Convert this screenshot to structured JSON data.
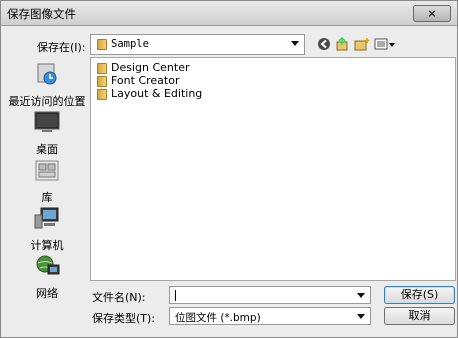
{
  "window": {
    "title": "保存图像文件",
    "close_label": "×"
  },
  "location": {
    "label": "保存在(I):",
    "folder": "Sample"
  },
  "toolbar": {
    "icons": [
      "back-icon",
      "up-folder-icon",
      "new-folder-icon",
      "view-menu-icon"
    ]
  },
  "places": [
    {
      "label": "最近访问的位置",
      "icon": "recent-places-icon"
    },
    {
      "label": "桌面",
      "icon": "desktop-icon"
    },
    {
      "label": "库",
      "icon": "libraries-icon"
    },
    {
      "label": "计算机",
      "icon": "computer-icon"
    },
    {
      "label": "网络",
      "icon": "network-icon"
    }
  ],
  "files": [
    {
      "name": "Design Center"
    },
    {
      "name": "Font Creator"
    },
    {
      "name": "Layout & Editing"
    }
  ],
  "filename": {
    "label": "文件名(N):",
    "value": ""
  },
  "filetype": {
    "label": "保存类型(T):",
    "value": "位图文件 (*.bmp)"
  },
  "buttons": {
    "save": "保存(S)",
    "cancel": "取消"
  }
}
